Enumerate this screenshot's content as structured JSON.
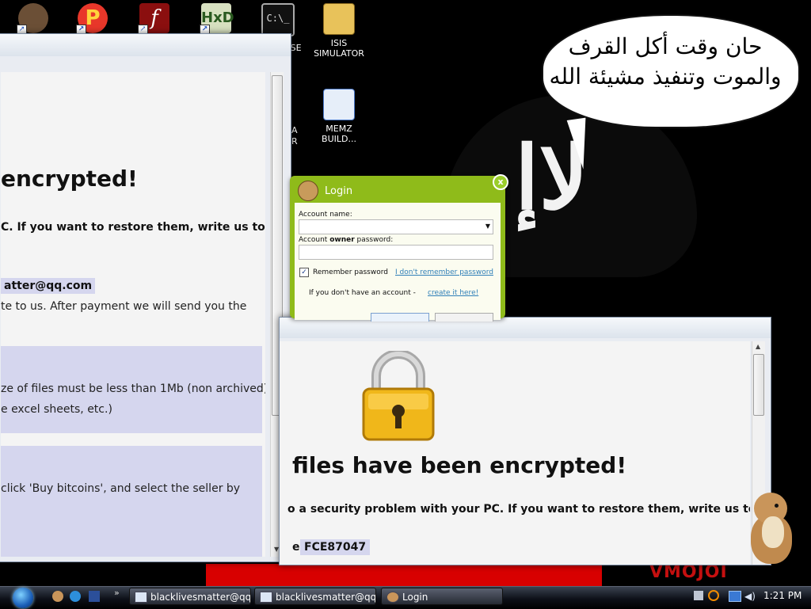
{
  "desktop": {
    "icons": [
      {
        "label": "",
        "color": "#7a5a3a"
      },
      {
        "label": "",
        "color": "#e4322c"
      },
      {
        "label": "",
        "color": "#9b1010"
      },
      {
        "label": "",
        "color": "#d9e2c4"
      },
      {
        "label": "PSE",
        "color": "#222222"
      },
      {
        "label": "ISIS SIMULATOR",
        "color": "#e9c45a"
      },
      {
        "label": "MEMZ BUILD...",
        "color": "#4a78c8"
      }
    ],
    "partial_icon_label_1": "A",
    "partial_icon_label_2": "R",
    "speech_line1": "حان وقت أكل القرف",
    "speech_line2": "والموت وتنفيذ مشيئة الله",
    "wallpaper_text": "VMOJOI",
    "wallpaper_glyph": "ﻻإ"
  },
  "ransom_left": {
    "heading": "encrypted!",
    "line1": "C. If you want to restore them, write us to",
    "email": "atter@qq.com",
    "line2": "te to us. After payment we will send you the",
    "box1_line1": "ze of files must be less than 1Mb (non archived),",
    "box1_line2": "e excel sheets, etc.)",
    "box2_line1": "click 'Buy bitcoins', and select the seller by"
  },
  "ransom_right": {
    "heading": "files have been encrypted!",
    "line1": "o a security problem with your PC. If you want to restore them, write us to",
    "id_prefix": "e",
    "id_value": "FCE87047"
  },
  "login": {
    "title": "Login",
    "account_name_label": "Account name:",
    "owner_password_label_pre": "Account ",
    "owner_password_label_bold": "owner",
    "owner_password_label_post": " password:",
    "remember_label": "Remember password",
    "forgot_link": "I don't remember password",
    "no_account_text": "If you don't have an account - ",
    "create_link": "create it here!",
    "close_glyph": "x"
  },
  "taskbar": {
    "items": [
      {
        "label": "blacklivesmatter@qq...."
      },
      {
        "label": "blacklivesmatter@qq...."
      },
      {
        "label": "Login"
      }
    ],
    "time": "1:21 PM"
  },
  "colors": {
    "login_green": "#8fbb1a",
    "wallpaper_red": "#d80000",
    "ransom_box": "#d5d6ee",
    "lock_gold": "#f0b71a"
  }
}
